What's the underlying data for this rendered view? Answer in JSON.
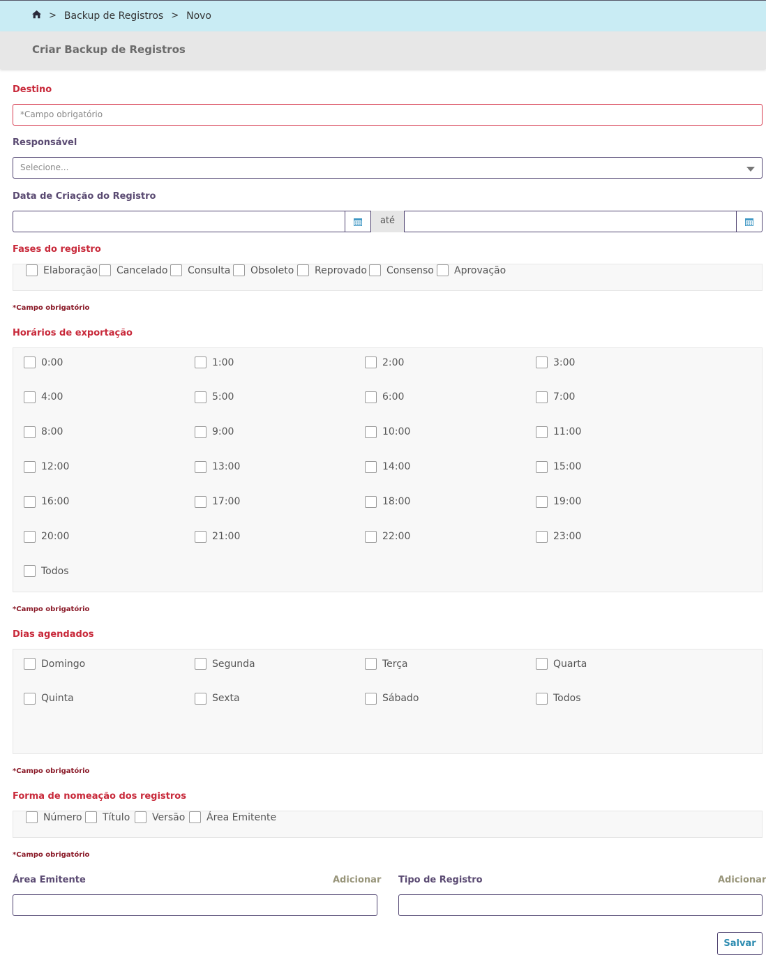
{
  "breadcrumb": {
    "home_icon": "home-icon",
    "items": [
      "Backup de Registros",
      "Novo"
    ],
    "separator": ">"
  },
  "page_title": "Criar Backup de Registros",
  "destino": {
    "label": "Destino",
    "placeholder": "*Campo obrigatório"
  },
  "responsavel": {
    "label": "Responsável",
    "placeholder": "Selecione..."
  },
  "data_criacao": {
    "label": "Data de Criação do Registro",
    "separator": "até",
    "icon": "calendar-icon"
  },
  "fases": {
    "label": "Fases do registro",
    "options": [
      "Elaboração",
      "Cancelado",
      "Consulta",
      "Obsoleto",
      "Reprovado",
      "Consenso",
      "Aprovação"
    ],
    "required_note": "*Campo obrigatório"
  },
  "horarios": {
    "label": "Horários de exportação",
    "options": [
      "0:00",
      "1:00",
      "2:00",
      "3:00",
      "4:00",
      "5:00",
      "6:00",
      "7:00",
      "8:00",
      "9:00",
      "10:00",
      "11:00",
      "12:00",
      "13:00",
      "14:00",
      "15:00",
      "16:00",
      "17:00",
      "18:00",
      "19:00",
      "20:00",
      "21:00",
      "22:00",
      "23:00",
      "Todos"
    ],
    "required_note": "*Campo obrigatório"
  },
  "dias": {
    "label": "Dias agendados",
    "options": [
      "Domingo",
      "Segunda",
      "Terça",
      "Quarta",
      "Quinta",
      "Sexta",
      "Sábado",
      "Todos"
    ],
    "required_note": "*Campo obrigatório"
  },
  "nomeacao": {
    "label": "Forma de nomeação dos registros",
    "options": [
      "Número",
      "Título",
      "Versão",
      "Área Emitente"
    ],
    "required_note": "*Campo obrigatório"
  },
  "area_emitente": {
    "label": "Área Emitente",
    "add": "Adicionar"
  },
  "tipo_registro": {
    "label": "Tipo de Registro",
    "add": "Adicionar"
  },
  "save_label": "Salvar",
  "colors": {
    "required_red": "#c8293a",
    "label_purple": "#5a4a72",
    "topbar": "#c9ecf4",
    "save_text": "#2c8bb0"
  }
}
